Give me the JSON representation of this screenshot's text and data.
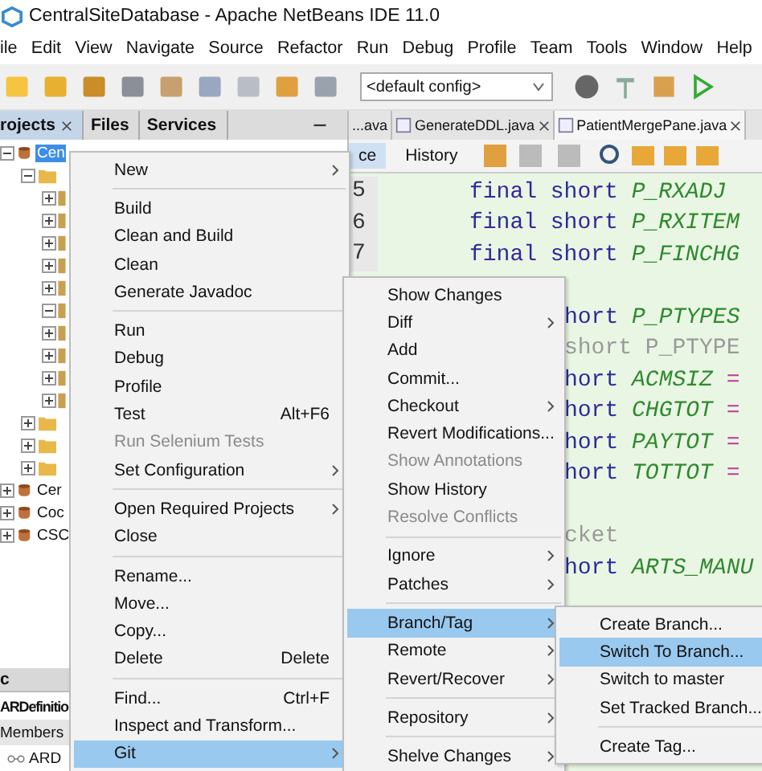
{
  "window": {
    "title": "CentralSiteDatabase - Apache NetBeans IDE 11.0"
  },
  "menu_bar": [
    "ile",
    "Edit",
    "View",
    "Navigate",
    "Source",
    "Refactor",
    "Run",
    "Debug",
    "Profile",
    "Team",
    "Tools",
    "Window",
    "Help"
  ],
  "toolbar": {
    "config": "<default config>"
  },
  "projects_panel": {
    "tabs": [
      {
        "label": "rojects",
        "selected": true,
        "closable": true
      },
      {
        "label": "Files",
        "selected": false,
        "closable": false
      },
      {
        "label": "Services",
        "selected": false,
        "closable": false
      }
    ],
    "tree": [
      {
        "label": "Cen",
        "kind": "project",
        "expanded": true,
        "selected": true,
        "children": [
          {
            "kind": "folder",
            "expanded": true,
            "selected": false,
            "children": [
              {
                "kind": "package",
                "expanded": false,
                "selected": false
              },
              {
                "kind": "package",
                "expanded": false,
                "selected": false
              },
              {
                "kind": "package",
                "expanded": false,
                "selected": false
              },
              {
                "kind": "package",
                "expanded": false,
                "selected": false
              },
              {
                "kind": "package",
                "expanded": false,
                "selected": false
              },
              {
                "kind": "package",
                "expanded": true,
                "selected": false
              },
              {
                "kind": "package",
                "expanded": false,
                "selected": false
              },
              {
                "kind": "package",
                "expanded": false,
                "selected": false
              },
              {
                "kind": "package",
                "expanded": false,
                "selected": false
              },
              {
                "kind": "package",
                "expanded": false,
                "selected": false
              }
            ]
          },
          {
            "kind": "folder",
            "expanded": false,
            "selected": false
          },
          {
            "kind": "folder",
            "expanded": false,
            "selected": false
          },
          {
            "kind": "folder",
            "expanded": false,
            "selected": false
          }
        ]
      },
      {
        "label": "Cer",
        "kind": "project",
        "expanded": false,
        "selected": false
      },
      {
        "label": "Coc",
        "kind": "project",
        "expanded": false,
        "selected": false
      },
      {
        "label": "CSC",
        "kind": "project",
        "expanded": false,
        "selected": false
      }
    ],
    "bottom_tab": "c"
  },
  "navigator": {
    "title": "ARDefinitio",
    "view": "Members",
    "items": [
      "ARD"
    ]
  },
  "editor": {
    "tabs": [
      {
        "label": "...ava",
        "selected": false,
        "closable": false
      },
      {
        "label": "GenerateDDL.java",
        "selected": false,
        "closable": true
      },
      {
        "label": "PatientMergePane.java",
        "selected": true,
        "closable": true
      }
    ],
    "views": [
      {
        "label": "ce",
        "selected": true
      },
      {
        "label": "History",
        "selected": false
      }
    ],
    "lines": [
      {
        "kind": "full",
        "number": "5",
        "tokens": [
          {
            "text": "final short ",
            "kind": "keyword"
          },
          {
            "text": "P_RXADJ",
            "kind": "constant"
          }
        ]
      },
      {
        "kind": "full",
        "number": "6",
        "tokens": [
          {
            "text": "final short ",
            "kind": "keyword"
          },
          {
            "text": "P_RXITEM",
            "kind": "constant"
          }
        ]
      },
      {
        "kind": "full",
        "number": "7",
        "tokens": [
          {
            "text": "final short ",
            "kind": "keyword"
          },
          {
            "text": "P_FINCHG",
            "kind": "constant"
          }
        ]
      },
      {
        "kind": "covered"
      },
      {
        "kind": "clipped",
        "tokens": [
          {
            "text": "hort ",
            "kind": "keyword"
          },
          {
            "text": "P_PTYPES",
            "kind": "constant"
          }
        ]
      },
      {
        "kind": "clipped",
        "tokens": [
          {
            "text": " short P_PTYPE",
            "kind": "comment"
          }
        ]
      },
      {
        "kind": "clipped",
        "tokens": [
          {
            "text": "hort ",
            "kind": "keyword"
          },
          {
            "text": "ACMSIZ",
            "kind": "constant"
          },
          {
            "text": " =",
            "kind": "operator"
          }
        ]
      },
      {
        "kind": "clipped",
        "tokens": [
          {
            "text": "hort ",
            "kind": "keyword"
          },
          {
            "text": "CHGTOT",
            "kind": "constant"
          },
          {
            "text": " =",
            "kind": "operator"
          }
        ]
      },
      {
        "kind": "clipped",
        "tokens": [
          {
            "text": "hort ",
            "kind": "keyword"
          },
          {
            "text": "PAYTOT",
            "kind": "constant"
          },
          {
            "text": " =",
            "kind": "operator"
          }
        ]
      },
      {
        "kind": "clipped",
        "tokens": [
          {
            "text": "hort ",
            "kind": "keyword"
          },
          {
            "text": "TOTTOT",
            "kind": "constant"
          },
          {
            "text": " =",
            "kind": "operator"
          }
        ]
      },
      {
        "kind": "blank"
      },
      {
        "kind": "clipped",
        "tokens": [
          {
            "text": "cket",
            "kind": "comment"
          }
        ]
      },
      {
        "kind": "clipped",
        "tokens": [
          {
            "text": "hort ",
            "kind": "keyword"
          },
          {
            "text": "ARTS_MANU",
            "kind": "constant"
          }
        ]
      }
    ]
  },
  "context_menu": [
    {
      "kind": "item",
      "label": "New",
      "submenu": true,
      "disabled": false,
      "selected": false
    },
    {
      "kind": "separator"
    },
    {
      "kind": "item",
      "label": "Build",
      "submenu": false,
      "disabled": false,
      "selected": false
    },
    {
      "kind": "item",
      "label": "Clean and Build",
      "submenu": false,
      "disabled": false,
      "selected": false
    },
    {
      "kind": "item",
      "label": "Clean",
      "submenu": false,
      "disabled": false,
      "selected": false
    },
    {
      "kind": "item",
      "label": "Generate Javadoc",
      "submenu": false,
      "disabled": false,
      "selected": false
    },
    {
      "kind": "separator"
    },
    {
      "kind": "item",
      "label": "Run",
      "submenu": false,
      "disabled": false,
      "selected": false
    },
    {
      "kind": "item",
      "label": "Debug",
      "submenu": false,
      "disabled": false,
      "selected": false
    },
    {
      "kind": "item",
      "label": "Profile",
      "submenu": false,
      "disabled": false,
      "selected": false
    },
    {
      "kind": "item",
      "label": "Test",
      "shortcut": "Alt+F6",
      "submenu": false,
      "disabled": false,
      "selected": false
    },
    {
      "kind": "item",
      "label": "Run Selenium Tests",
      "submenu": false,
      "disabled": true,
      "selected": false
    },
    {
      "kind": "item",
      "label": "Set Configuration",
      "submenu": true,
      "disabled": false,
      "selected": false
    },
    {
      "kind": "separator"
    },
    {
      "kind": "item",
      "label": "Open Required Projects",
      "submenu": true,
      "disabled": false,
      "selected": false
    },
    {
      "kind": "item",
      "label": "Close",
      "submenu": false,
      "disabled": false,
      "selected": false
    },
    {
      "kind": "separator"
    },
    {
      "kind": "item",
      "label": "Rename...",
      "submenu": false,
      "disabled": false,
      "selected": false
    },
    {
      "kind": "item",
      "label": "Move...",
      "submenu": false,
      "disabled": false,
      "selected": false
    },
    {
      "kind": "item",
      "label": "Copy...",
      "submenu": false,
      "disabled": false,
      "selected": false
    },
    {
      "kind": "item",
      "label": "Delete",
      "shortcut": "Delete",
      "submenu": false,
      "disabled": false,
      "selected": false
    },
    {
      "kind": "separator"
    },
    {
      "kind": "item",
      "label": "Find...",
      "shortcut": "Ctrl+F",
      "submenu": false,
      "disabled": false,
      "selected": false
    },
    {
      "kind": "item",
      "label": "Inspect and Transform...",
      "submenu": false,
      "disabled": false,
      "selected": false
    },
    {
      "kind": "item",
      "label": "Git",
      "submenu": true,
      "disabled": false,
      "selected": true
    }
  ],
  "git_menu": [
    {
      "kind": "item",
      "label": "Show Changes",
      "submenu": false,
      "disabled": false,
      "selected": false
    },
    {
      "kind": "item",
      "label": "Diff",
      "submenu": true,
      "disabled": false,
      "selected": false
    },
    {
      "kind": "item",
      "label": "Add",
      "submenu": false,
      "disabled": false,
      "selected": false
    },
    {
      "kind": "item",
      "label": "Commit...",
      "submenu": false,
      "disabled": false,
      "selected": false
    },
    {
      "kind": "item",
      "label": "Checkout",
      "submenu": true,
      "disabled": false,
      "selected": false
    },
    {
      "kind": "item",
      "label": "Revert Modifications...",
      "submenu": false,
      "disabled": false,
      "selected": false
    },
    {
      "kind": "item",
      "label": "Show Annotations",
      "submenu": false,
      "disabled": true,
      "selected": false
    },
    {
      "kind": "item",
      "label": "Show History",
      "submenu": false,
      "disabled": false,
      "selected": false
    },
    {
      "kind": "item",
      "label": "Resolve Conflicts",
      "submenu": false,
      "disabled": true,
      "selected": false
    },
    {
      "kind": "separator"
    },
    {
      "kind": "item",
      "label": "Ignore",
      "submenu": true,
      "disabled": false,
      "selected": false
    },
    {
      "kind": "item",
      "label": "Patches",
      "submenu": true,
      "disabled": false,
      "selected": false
    },
    {
      "kind": "separator"
    },
    {
      "kind": "item",
      "label": "Branch/Tag",
      "submenu": true,
      "disabled": false,
      "selected": true
    },
    {
      "kind": "item",
      "label": "Remote",
      "submenu": true,
      "disabled": false,
      "selected": false
    },
    {
      "kind": "item",
      "label": "Revert/Recover",
      "submenu": true,
      "disabled": false,
      "selected": false
    },
    {
      "kind": "separator"
    },
    {
      "kind": "item",
      "label": "Repository",
      "submenu": true,
      "disabled": false,
      "selected": false
    },
    {
      "kind": "separator"
    },
    {
      "kind": "item",
      "label": "Shelve Changes",
      "submenu": true,
      "disabled": false,
      "selected": false
    }
  ],
  "branch_menu": [
    {
      "kind": "item",
      "label": "Create Branch...",
      "submenu": false,
      "disabled": false,
      "selected": false
    },
    {
      "kind": "item",
      "label": "Switch To Branch...",
      "submenu": false,
      "disabled": false,
      "selected": true
    },
    {
      "kind": "item",
      "label": "Switch to master",
      "submenu": false,
      "disabled": false,
      "selected": false
    },
    {
      "kind": "item",
      "label": "Set Tracked Branch...",
      "submenu": false,
      "disabled": false,
      "selected": false
    },
    {
      "kind": "separator"
    },
    {
      "kind": "item",
      "label": "Create Tag...",
      "submenu": false,
      "disabled": false,
      "selected": false
    }
  ]
}
